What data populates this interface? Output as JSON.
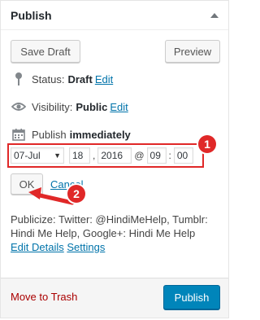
{
  "header": {
    "title": "Publish"
  },
  "buttons": {
    "save_draft": "Save Draft",
    "preview": "Preview",
    "ok": "OK",
    "cancel": "Cancel",
    "publish": "Publish"
  },
  "status": {
    "label": "Status:",
    "value": "Draft",
    "edit": "Edit"
  },
  "visibility": {
    "label": "Visibility:",
    "value": "Public",
    "edit": "Edit"
  },
  "schedule": {
    "label": "Publish",
    "value": "immediately"
  },
  "date": {
    "month": "07-Jul",
    "day": "18",
    "year": "2016",
    "at": "@",
    "hour": "09",
    "minute": "00",
    "comma": ",",
    "colon": ":"
  },
  "annotations": {
    "badge1": "1",
    "badge2": "2",
    "color": "#e02828"
  },
  "publicize": {
    "text": "Publicize: Twitter: @HindiMeHelp, Tumblr: Hindi Me Help, Google+: Hindi Me Help",
    "edit_details": "Edit Details",
    "settings": "Settings"
  },
  "footer": {
    "trash": "Move to Trash"
  },
  "colors": {
    "link": "#0073aa",
    "primary": "#0085ba",
    "trash": "#aa0000"
  }
}
